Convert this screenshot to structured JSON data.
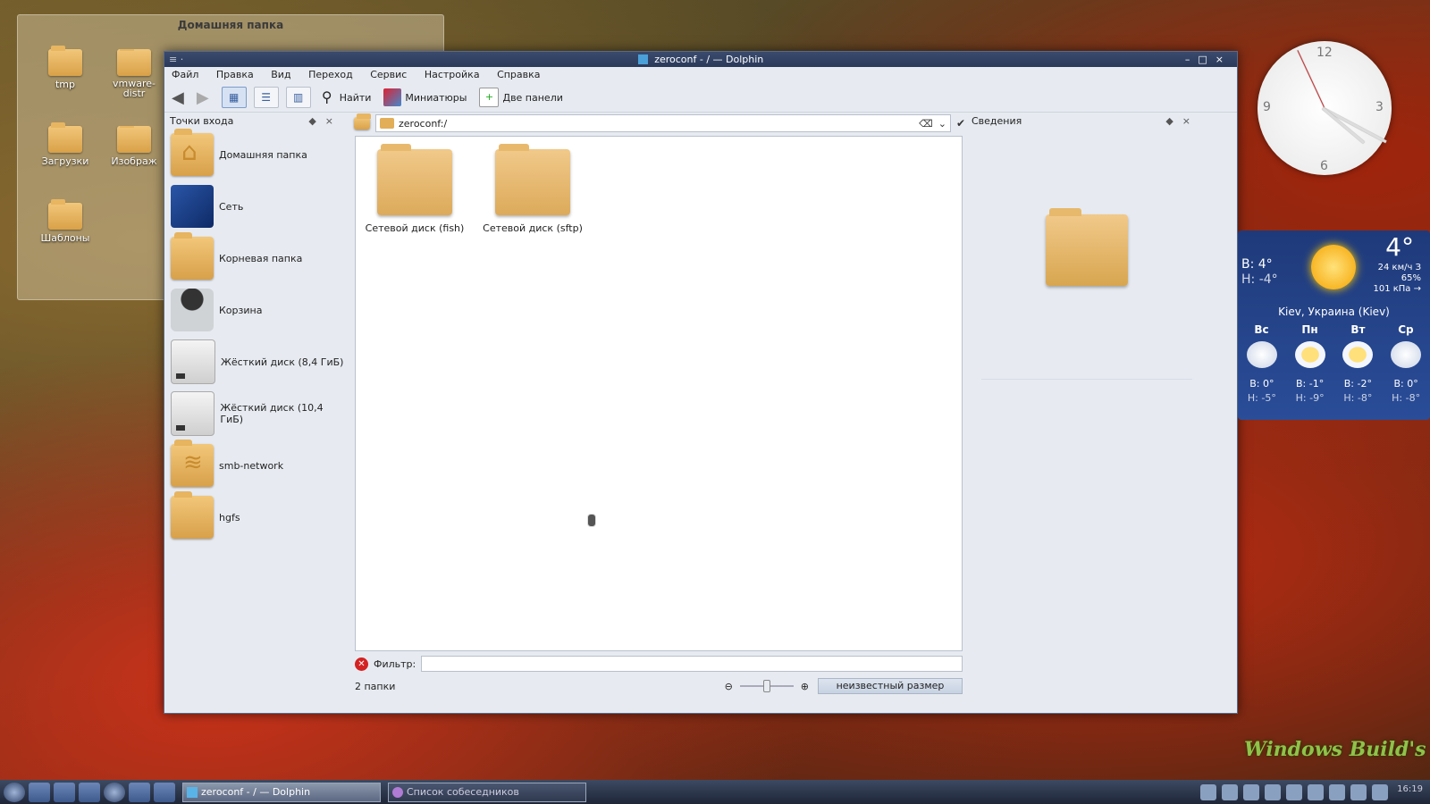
{
  "desktop_widget": {
    "title": "Домашняя папка",
    "icons": [
      {
        "label": "tmp"
      },
      {
        "label": "vmware-\ndistr"
      },
      {
        "label": "Загрузки"
      },
      {
        "label": "Изображ"
      },
      {
        "label": "Шаблоны"
      }
    ]
  },
  "window": {
    "title": "zeroconf - / — Dolphin",
    "menu": [
      "Файл",
      "Правка",
      "Вид",
      "Переход",
      "Сервис",
      "Настройка",
      "Справка"
    ],
    "toolbar": {
      "find": "Найти",
      "previews": "Миниатюры",
      "split": "Две панели"
    },
    "places": {
      "title": "Точки входа",
      "items": [
        {
          "label": "Домашняя папка",
          "icon": "home-folder-icon"
        },
        {
          "label": "Сеть",
          "icon": "network-icon"
        },
        {
          "label": "Корневая папка",
          "icon": "folder-icon"
        },
        {
          "label": "Корзина",
          "icon": "trash-icon"
        },
        {
          "label": "Жёсткий диск (8,4 ГиБ)",
          "icon": "hard-disk-icon"
        },
        {
          "label": "Жёсткий диск (10,4 ГиБ)",
          "icon": "hard-disk-icon"
        },
        {
          "label": "smb-network",
          "icon": "wifi-folder-icon"
        },
        {
          "label": "hgfs",
          "icon": "folder-icon"
        }
      ]
    },
    "location": "zeroconf:/",
    "files": [
      {
        "label": "Сетевой диск (fish)"
      },
      {
        "label": "Сетевой диск (sftp)"
      }
    ],
    "filter": {
      "label": "Фильтр:",
      "value": ""
    },
    "status": {
      "count": "2 папки",
      "size": "неизвестный размер"
    },
    "info_panel": {
      "title": "Сведения"
    }
  },
  "clock": {
    "numbers": [
      "12",
      "3",
      "6",
      "9"
    ]
  },
  "weather": {
    "temp": "4°",
    "high": "В: 4°",
    "low": "Н: -4°",
    "wind": "24 км/ч З",
    "humidity": "65%",
    "pressure": "101 кПа →",
    "city": "Kiev, Украина (Kiev)",
    "days": [
      {
        "day": "Вс",
        "high": "В: 0°",
        "low": "Н: -5°"
      },
      {
        "day": "Пн",
        "high": "В: -1°",
        "low": "Н: -9°"
      },
      {
        "day": "Вт",
        "high": "В: -2°",
        "low": "Н: -8°"
      },
      {
        "day": "Ср",
        "high": "В: 0°",
        "low": "Н: -8°"
      }
    ]
  },
  "brand": "Windows Build's",
  "taskbar": {
    "tasks": [
      "zeroconf - / — Dolphin",
      "Список собеседников"
    ],
    "time": "16:19"
  }
}
